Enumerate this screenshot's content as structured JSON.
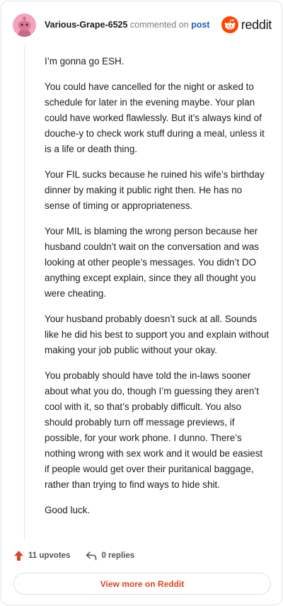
{
  "header": {
    "username": "Various-Grape-6525",
    "commented_on": "commented on",
    "post_link": "post",
    "brand": "reddit"
  },
  "comment": {
    "paragraphs": [
      "I’m gonna go ESH.",
      "You could have cancelled for the night or asked to schedule for later in the evening maybe. Your plan could have worked flawlessly. But it’s always kind of douche-y to check work stuff during a meal, unless it is a life or death thing.",
      "Your FIL sucks because he ruined his wife’s birthday dinner by making it public right then. He has no sense of timing or appropriateness.",
      "Your MIL is blaming the wrong person because her husband couldn’t wait on the conversation and was looking at other people’s messages. You didn’t DO anything except explain, since they all thought you were cheating.",
      "Your husband probably doesn’t suck at all. Sounds like he did his best to support you and explain without making your job public without your okay.",
      "You probably should have told the in-laws sooner about what you do, though I’m guessing they aren’t cool with it, so that’s probably difficult. You also should probably turn off message previews, if possible, for your work phone. I dunno. There’s nothing wrong with sex work and it would be easiest if people would get over their puritanical baggage, rather than trying to find ways to hide shit.",
      "Good luck."
    ]
  },
  "footer": {
    "upvotes": "11 upvotes",
    "replies": "0 replies",
    "view_more": "View more on Reddit"
  },
  "colors": {
    "accent": "#e0431f",
    "link": "#1e63b5",
    "avatar_bg": "#f5a3ba",
    "upvote": "#e0431f"
  },
  "icons": {
    "avatar": "snoo-avatar-icon",
    "brand": "reddit-logo-icon",
    "upvote": "upvote-arrow-icon",
    "reply": "reply-arrow-icon"
  }
}
